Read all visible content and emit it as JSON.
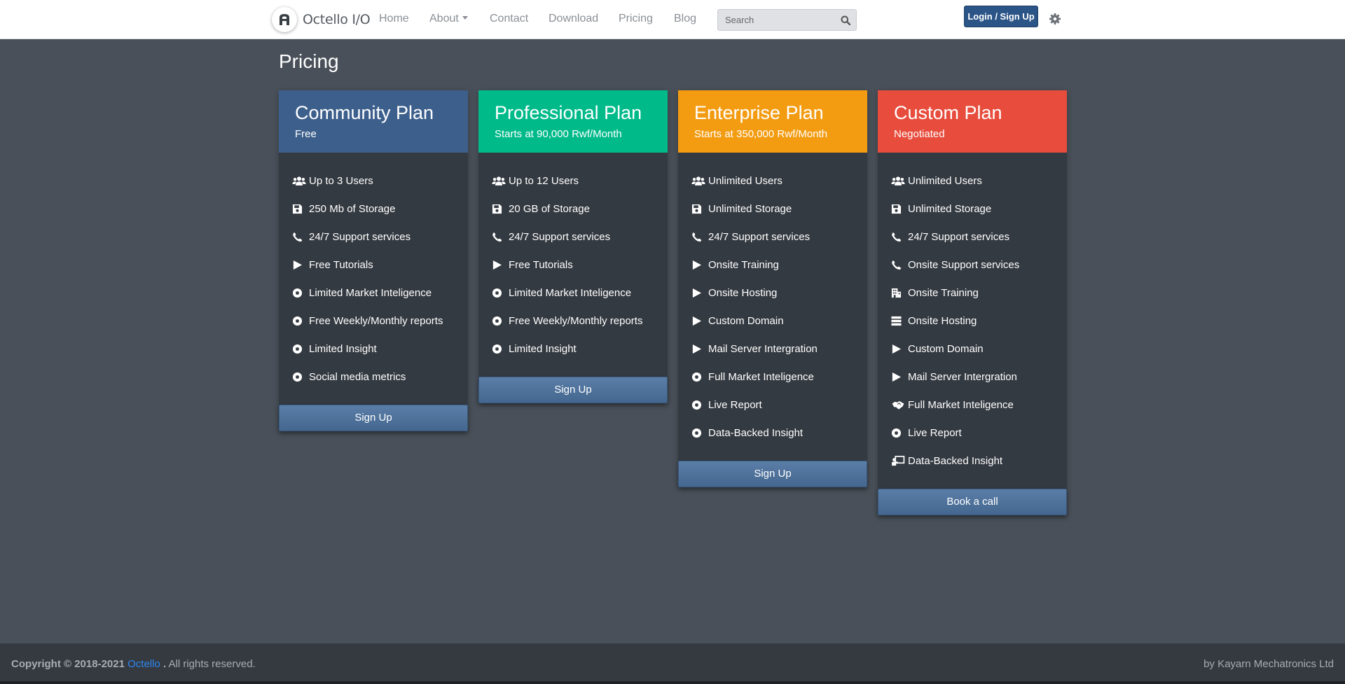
{
  "nav": {
    "brand": "Octello I/O",
    "links": [
      "Home",
      "About",
      "Contact",
      "Download",
      "Pricing",
      "Blog"
    ],
    "search_placeholder": "Search",
    "login_label": "Login / Sign Up"
  },
  "page": {
    "title": "Pricing"
  },
  "colors": {
    "community": "#3d5f8c",
    "professional": "#00ba8a",
    "enterprise": "#f39c12",
    "custom": "#e74c3c"
  },
  "plans": [
    {
      "title": "Community Plan",
      "subtitle": "Free",
      "features": [
        {
          "icon": "users-icon",
          "text": "Up to 3 Users"
        },
        {
          "icon": "save-icon",
          "text": "250 Mb of Storage"
        },
        {
          "icon": "phone-icon",
          "text": "24/7 Support services"
        },
        {
          "icon": "play-icon",
          "text": "Free Tutorials"
        },
        {
          "icon": "dot-circle-icon",
          "text": "Limited Market Inteligence"
        },
        {
          "icon": "dot-circle-icon",
          "text": "Free Weekly/Monthly reports"
        },
        {
          "icon": "dot-circle-icon",
          "text": "Limited Insight"
        },
        {
          "icon": "dot-circle-icon",
          "text": "Social media metrics"
        }
      ],
      "button": "Sign Up"
    },
    {
      "title": "Professional Plan",
      "subtitle": "Starts at 90,000 Rwf/Month",
      "features": [
        {
          "icon": "users-icon",
          "text": "Up to 12 Users"
        },
        {
          "icon": "save-icon",
          "text": "20 GB of Storage"
        },
        {
          "icon": "phone-icon",
          "text": "24/7 Support services"
        },
        {
          "icon": "play-icon",
          "text": "Free Tutorials"
        },
        {
          "icon": "dot-circle-icon",
          "text": "Limited Market Inteligence"
        },
        {
          "icon": "dot-circle-icon",
          "text": "Free Weekly/Monthly reports"
        },
        {
          "icon": "dot-circle-icon",
          "text": "Limited Insight"
        }
      ],
      "button": "Sign Up"
    },
    {
      "title": "Enterprise Plan",
      "subtitle": "Starts at 350,000 Rwf/Month",
      "features": [
        {
          "icon": "users-icon",
          "text": "Unlimited Users"
        },
        {
          "icon": "save-icon",
          "text": "Unlimited Storage"
        },
        {
          "icon": "phone-icon",
          "text": "24/7 Support services"
        },
        {
          "icon": "play-icon",
          "text": "Onsite Training"
        },
        {
          "icon": "play-icon",
          "text": "Onsite Hosting"
        },
        {
          "icon": "play-icon",
          "text": "Custom Domain"
        },
        {
          "icon": "play-icon",
          "text": "Mail Server Intergration"
        },
        {
          "icon": "dot-circle-icon",
          "text": "Full Market Inteligence"
        },
        {
          "icon": "dot-circle-icon",
          "text": "Live Report"
        },
        {
          "icon": "dot-circle-icon",
          "text": "Data-Backed Insight"
        }
      ],
      "button": "Sign Up"
    },
    {
      "title": "Custom Plan",
      "subtitle": "Negotiated",
      "features": [
        {
          "icon": "users-icon",
          "text": "Unlimited Users"
        },
        {
          "icon": "save-icon",
          "text": "Unlimited Storage"
        },
        {
          "icon": "phone-icon",
          "text": "24/7 Support services"
        },
        {
          "icon": "phone-icon",
          "text": "Onsite Support services"
        },
        {
          "icon": "building-icon",
          "text": "Onsite Training"
        },
        {
          "icon": "server-icon",
          "text": "Onsite Hosting"
        },
        {
          "icon": "play-icon",
          "text": "Custom Domain"
        },
        {
          "icon": "play-icon",
          "text": "Mail Server Intergration"
        },
        {
          "icon": "handshake-icon",
          "text": "Full Market Inteligence"
        },
        {
          "icon": "dot-circle-icon",
          "text": "Live Report"
        },
        {
          "icon": "chalkboard-teacher-icon",
          "text": "Data-Backed Insight"
        }
      ],
      "button": "Book a call"
    }
  ],
  "footer": {
    "copyright_prefix": "Copyright © 2018-2021",
    "copyright_brand": "Octello",
    "copyright_suffix": ". All rights reserved.",
    "byline": "by Kayarn Mechatronics Ltd"
  }
}
